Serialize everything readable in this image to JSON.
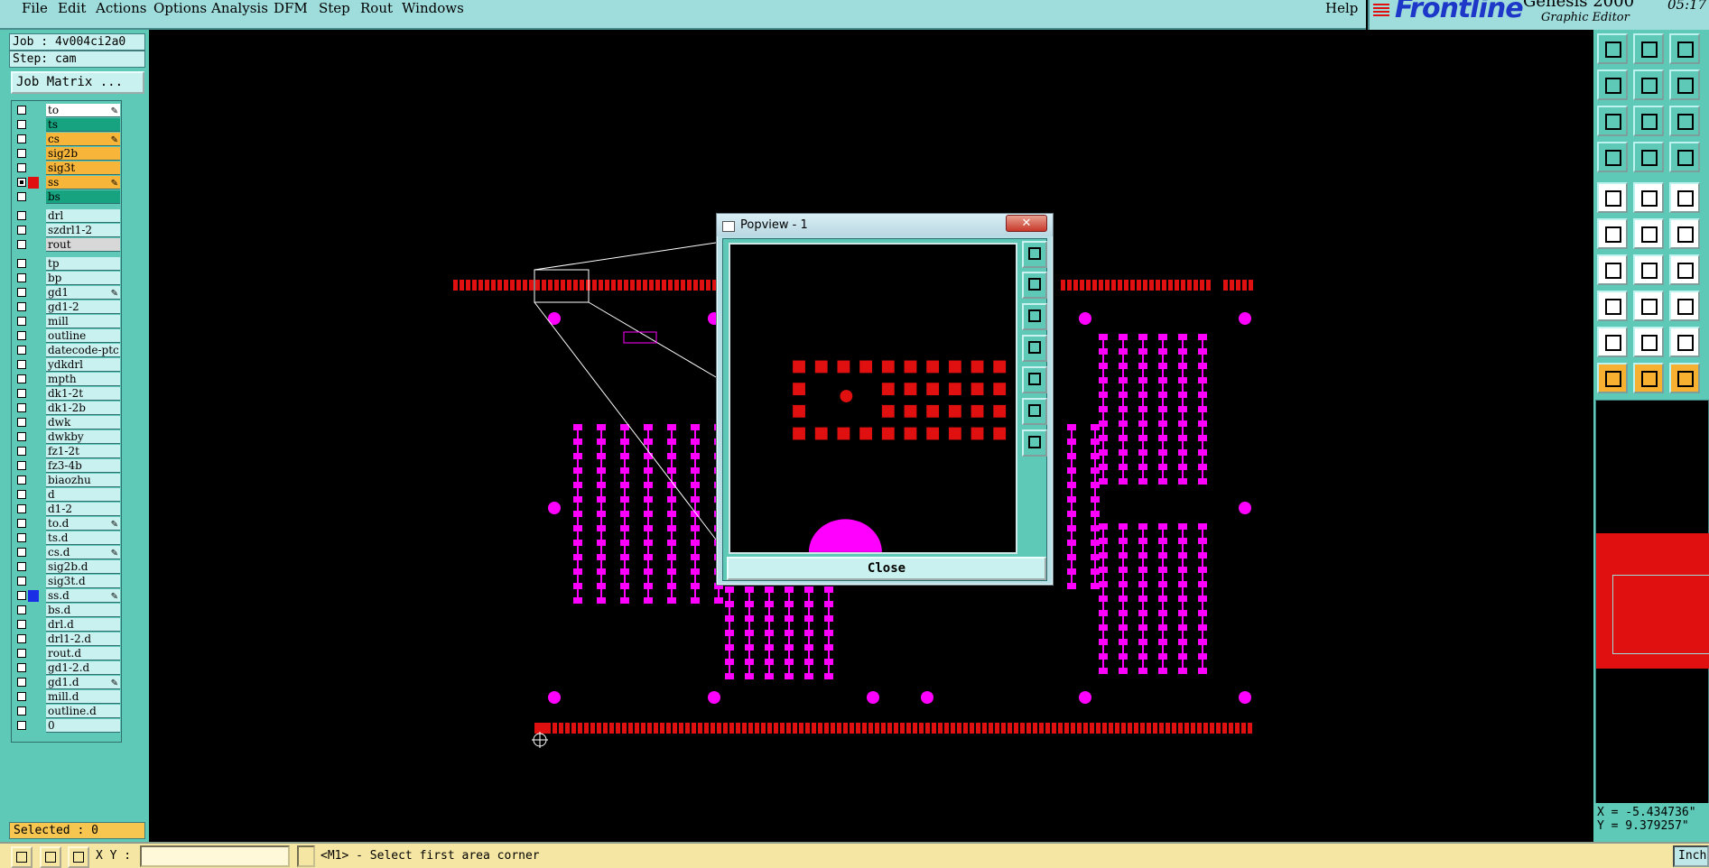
{
  "menu": {
    "items": [
      "File",
      "Edit",
      "Actions",
      "Options",
      "Analysis",
      "DFM",
      "Step",
      "Rout",
      "Windows"
    ],
    "help": "Help"
  },
  "brand": {
    "logo": "Frontline",
    "product": "Genesis 2000",
    "subtitle": "Graphic Editor",
    "time": "05:17"
  },
  "left": {
    "job": "Job : 4v004ci2a0",
    "step": "Step: cam",
    "job_matrix": "Job Matrix ...",
    "selected": "Selected : 0"
  },
  "layers": [
    {
      "name": "to",
      "color": "#ffffff",
      "edit": true
    },
    {
      "name": "ts",
      "color": "#17a37f"
    },
    {
      "name": "cs",
      "color": "#f7b53a",
      "edit": true
    },
    {
      "name": "sig2b",
      "color": "#f7b53a"
    },
    {
      "name": "sig3t",
      "color": "#f7b53a"
    },
    {
      "name": "ss",
      "color": "#f7b53a",
      "edit": true,
      "active": true,
      "swatch": "#e01010"
    },
    {
      "name": "bs",
      "color": "#17a37f"
    },
    {
      "name": "drl",
      "color": "#c9f1ef",
      "gap": true
    },
    {
      "name": "szdrl1-2",
      "color": "#c9f1ef"
    },
    {
      "name": "rout",
      "color": "#d8d8d8"
    },
    {
      "name": "tp",
      "color": "#c9f1ef",
      "gap": true
    },
    {
      "name": "bp",
      "color": "#c9f1ef"
    },
    {
      "name": "gd1",
      "color": "#c9f1ef",
      "edit": true
    },
    {
      "name": "gd1-2",
      "color": "#c9f1ef"
    },
    {
      "name": "mill",
      "color": "#c9f1ef"
    },
    {
      "name": "outline",
      "color": "#c9f1ef"
    },
    {
      "name": "datecode-ptc",
      "color": "#c9f1ef"
    },
    {
      "name": "ydkdrl",
      "color": "#c9f1ef"
    },
    {
      "name": "mpth",
      "color": "#c9f1ef"
    },
    {
      "name": "dk1-2t",
      "color": "#c9f1ef"
    },
    {
      "name": "dk1-2b",
      "color": "#c9f1ef"
    },
    {
      "name": "dwk",
      "color": "#c9f1ef"
    },
    {
      "name": "dwkby",
      "color": "#c9f1ef"
    },
    {
      "name": "fz1-2t",
      "color": "#c9f1ef"
    },
    {
      "name": "fz3-4b",
      "color": "#c9f1ef"
    },
    {
      "name": "biaozhu",
      "color": "#c9f1ef"
    },
    {
      "name": "d",
      "color": "#c9f1ef"
    },
    {
      "name": "d1-2",
      "color": "#c9f1ef"
    },
    {
      "name": "to.d",
      "color": "#c9f1ef",
      "edit": true
    },
    {
      "name": "ts.d",
      "color": "#c9f1ef"
    },
    {
      "name": "cs.d",
      "color": "#c9f1ef",
      "edit": true
    },
    {
      "name": "sig2b.d",
      "color": "#c9f1ef"
    },
    {
      "name": "sig3t.d",
      "color": "#c9f1ef"
    },
    {
      "name": "ss.d",
      "color": "#c9f1ef",
      "edit": true,
      "swatch": "#1a2ee6"
    },
    {
      "name": "bs.d",
      "color": "#c9f1ef"
    },
    {
      "name": "drl.d",
      "color": "#c9f1ef"
    },
    {
      "name": "drl1-2.d",
      "color": "#c9f1ef"
    },
    {
      "name": "rout.d",
      "color": "#c9f1ef"
    },
    {
      "name": "gd1-2.d",
      "color": "#c9f1ef"
    },
    {
      "name": "gd1.d",
      "color": "#c9f1ef",
      "edit": true
    },
    {
      "name": "mill.d",
      "color": "#c9f1ef"
    },
    {
      "name": "outline.d",
      "color": "#c9f1ef"
    },
    {
      "name": "0",
      "color": "#c9f1ef"
    }
  ],
  "popview": {
    "title": "Popview - 1",
    "close_x": "✕",
    "close_label": "Close"
  },
  "coords": {
    "x": "X = -5.434736\"",
    "y": "Y = 9.379257\""
  },
  "status": {
    "xy_label": "X Y :",
    "xy_value": "",
    "message": "<M1> - Select first area corner",
    "unit": "Inch"
  },
  "colors": {
    "pad": "#ff00ff",
    "copper": "#e01010",
    "panel": "#5dc9b6"
  }
}
